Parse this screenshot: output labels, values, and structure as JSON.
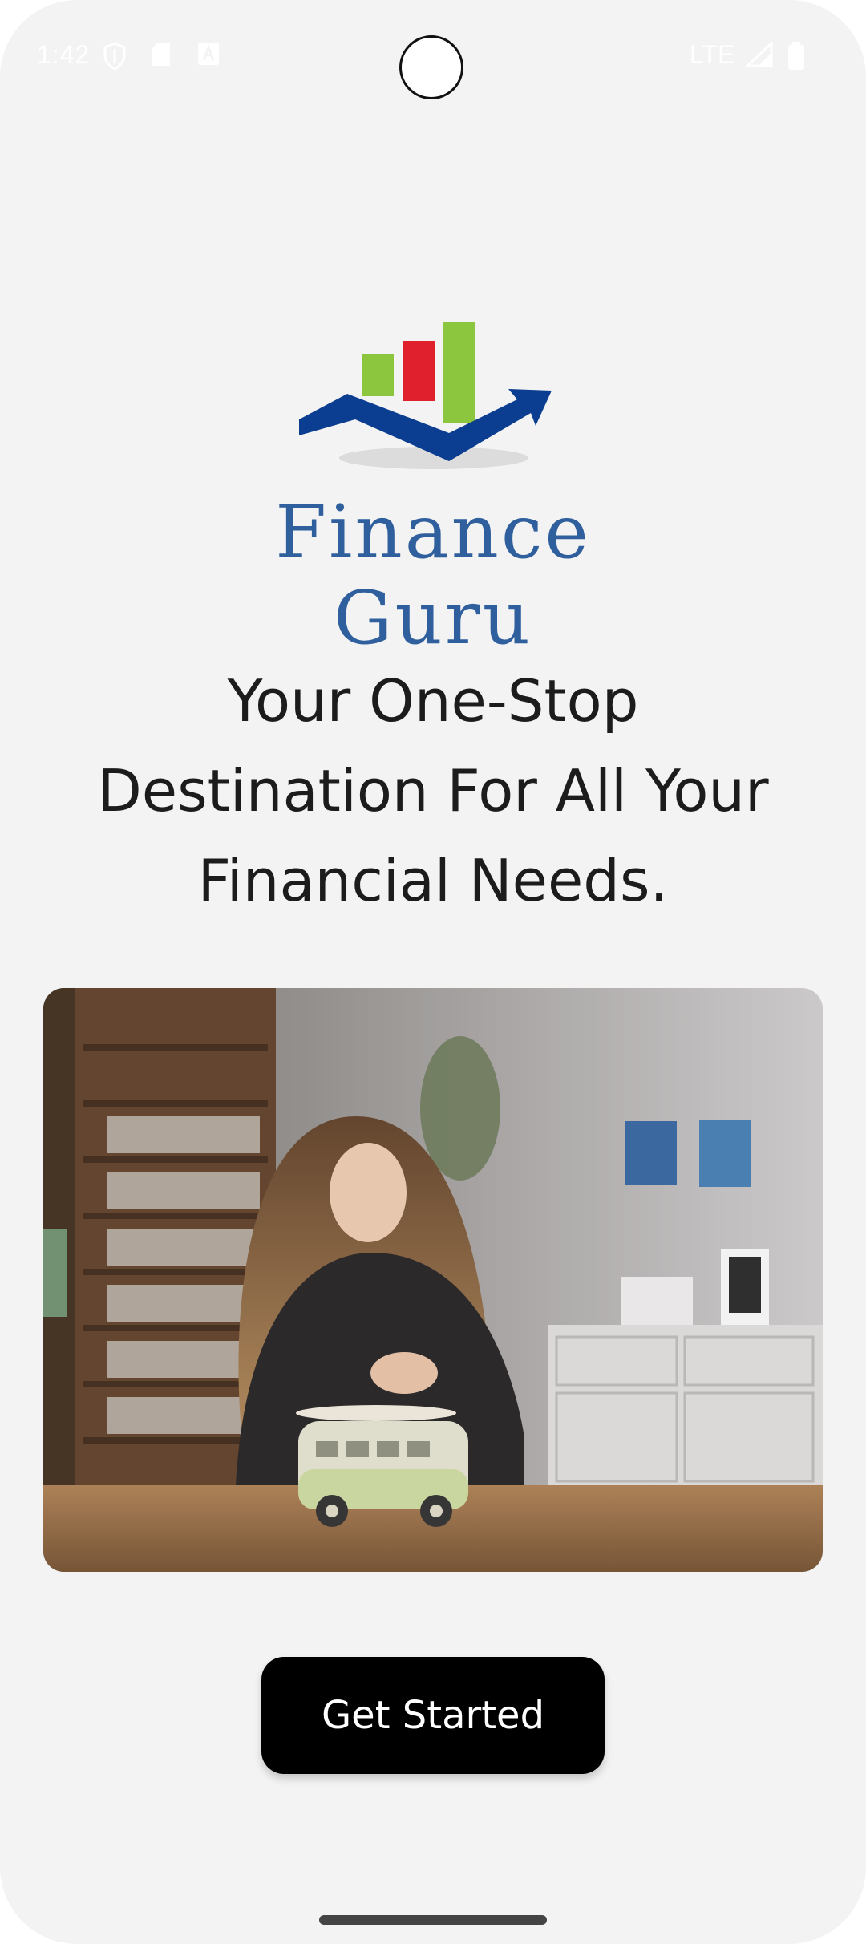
{
  "status_bar": {
    "time": "1:42",
    "network": "LTE",
    "icons": [
      "shield-icon",
      "sd-card-icon",
      "a-badge-icon",
      "signal-icon",
      "battery-icon"
    ]
  },
  "logo": {
    "brand_name": "Finance Guru",
    "colors": {
      "bar_green": "#8cc63f",
      "bar_red": "#e0212d",
      "arrow_blue": "#0b3d91",
      "wordmark": "#2f5f9d"
    }
  },
  "headline": {
    "line1": "Your One-Stop",
    "line2": "Destination For All Your",
    "line3": "Financial Needs."
  },
  "hero_image": {
    "description_icon": "photo-girl-piggy-bank-bus"
  },
  "cta": {
    "label": "Get Started"
  },
  "colors": {
    "background": "#f3f3f3",
    "button": "#000000",
    "button_text": "#ffffff",
    "headline_text": "#1c1c1c"
  }
}
